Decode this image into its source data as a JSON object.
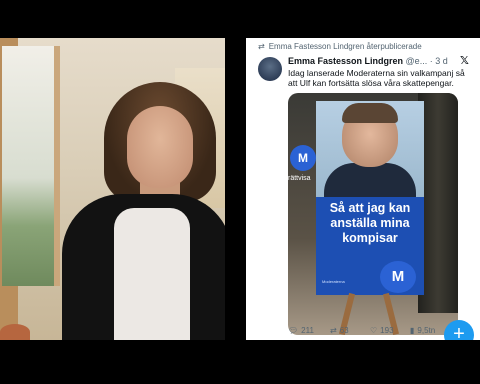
{
  "tweet": {
    "repost_label": "Emma Fastesson Lindgren återpublicerade",
    "author_name": "Emma Fastesson Lindgren",
    "handle_time": "@e... · 3 d",
    "text": "Idag lanserade Moderaterna sin valkampanj så att Ulf kan fortsätta slösa våra skattepengar.",
    "x_logo": "𝕏",
    "media": {
      "slogan": "Så att jag kan anställa mina kompisar",
      "logo_letter": "M",
      "side_text": "rättvisa",
      "small_print": "Moderaterna"
    },
    "actions": {
      "replies": "211",
      "reposts": "63",
      "likes": "193",
      "views": "9,5tn"
    },
    "compose_label": "+"
  },
  "colors": {
    "accent": "#1d9bf0",
    "moderaterna_blue": "#1d4fb3"
  },
  "icons": [
    "repost-icon",
    "x-logo-icon",
    "reply-icon",
    "like-icon",
    "views-icon",
    "compose-icon"
  ]
}
